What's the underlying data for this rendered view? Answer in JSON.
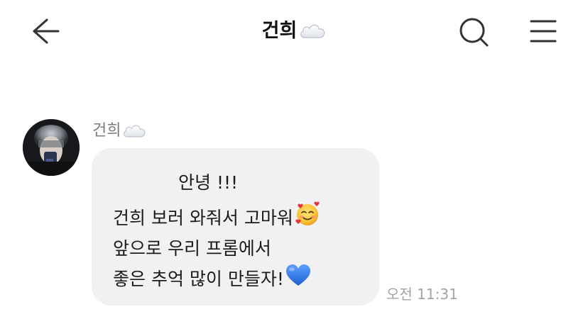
{
  "header": {
    "title": "건희",
    "title_icon": "cloud-icon",
    "back_icon": "back-arrow-icon",
    "search_icon": "search-icon",
    "menu_icon": "menu-icon"
  },
  "message": {
    "sender_name": "건희",
    "sender_icon": "cloud-icon",
    "lines": [
      "안녕 !!!",
      "건희 보러 와줘서 고마워",
      "앞으로 우리 프롬에서",
      "좋은 추억 많이 만들자!"
    ],
    "line_emojis": [
      "",
      "smiling-face-with-hearts-icon",
      "",
      "blue-heart-icon"
    ],
    "time": "오전 11:31"
  },
  "colors": {
    "bubble": "#f1f1f4",
    "timestamp": "#a3a3a3",
    "sender": "#7c7c7c",
    "heart_blue": "#2f7be5"
  }
}
